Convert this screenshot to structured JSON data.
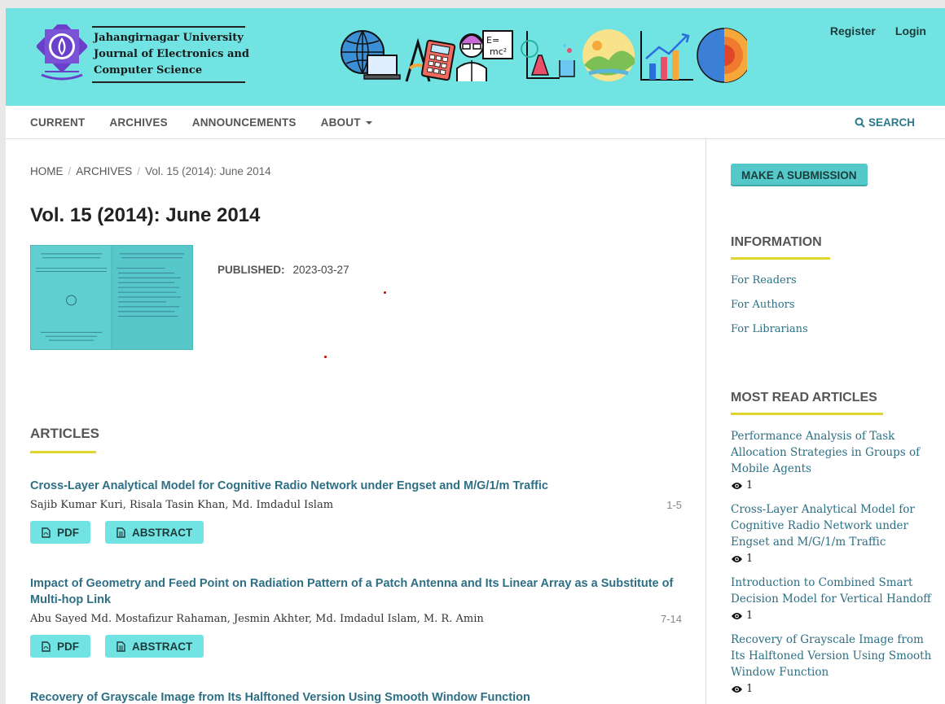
{
  "header": {
    "journal_lines": [
      "Jahangirnagar University",
      "Journal of Electronics and",
      "Computer Science"
    ],
    "register_label": "Register",
    "login_label": "Login"
  },
  "nav": {
    "items": [
      "CURRENT",
      "ARCHIVES",
      "ANNOUNCEMENTS",
      "ABOUT"
    ],
    "search_label": "SEARCH"
  },
  "breadcrumb": {
    "home": "HOME",
    "archives": "ARCHIVES",
    "current": "Vol. 15 (2014): June 2014"
  },
  "issue": {
    "title": "Vol. 15 (2014): June 2014",
    "published_label": "PUBLISHED:",
    "published_date": "2023-03-27"
  },
  "articles_heading": "ARTICLES",
  "articles": [
    {
      "title": "Cross-Layer Analytical Model for Cognitive Radio Network under Engset and M/G/1/m Traffic",
      "authors": "Sajib Kumar Kuri, Risala Tasin Khan, Md. Imdadul Islam",
      "pages": "1-5",
      "pdf_label": "PDF",
      "abstract_label": "ABSTRACT"
    },
    {
      "title": "Impact of Geometry and Feed Point on Radiation Pattern of a Patch Antenna and Its Linear Array as a Substitute of Multi-hop Link",
      "authors": "Abu Sayed Md. Mostafizur Rahaman, Jesmin Akhter, Md. Imdadul Islam, M. R. Amin",
      "pages": "7-14",
      "pdf_label": "PDF",
      "abstract_label": "ABSTRACT"
    },
    {
      "title": "Recovery of Grayscale Image from Its Halftoned Version Using Smooth Window Function"
    }
  ],
  "sidebar": {
    "submit_label": "MAKE A SUBMISSION",
    "information_heading": "INFORMATION",
    "information_links": [
      "For Readers",
      "For Authors",
      "For Librarians"
    ],
    "most_read_heading": "MOST READ ARTICLES",
    "most_read": [
      {
        "title": "Performance Analysis of Task Allocation Strategies in Groups of Mobile Agents",
        "views": "1"
      },
      {
        "title": "Cross-Layer Analytical Model for Cognitive Radio Network under Engset and M/G/1/m Traffic",
        "views": "1"
      },
      {
        "title": "Introduction to Combined Smart Decision Model for Vertical Handoff",
        "views": "1"
      },
      {
        "title": "Recovery of Grayscale Image from Its Halftoned Version Using Smooth Window Function",
        "views": "1"
      }
    ]
  },
  "colors": {
    "header_bg": "#72e3e3",
    "link": "#2d6f84",
    "accent_underline": "#e0d52a"
  }
}
